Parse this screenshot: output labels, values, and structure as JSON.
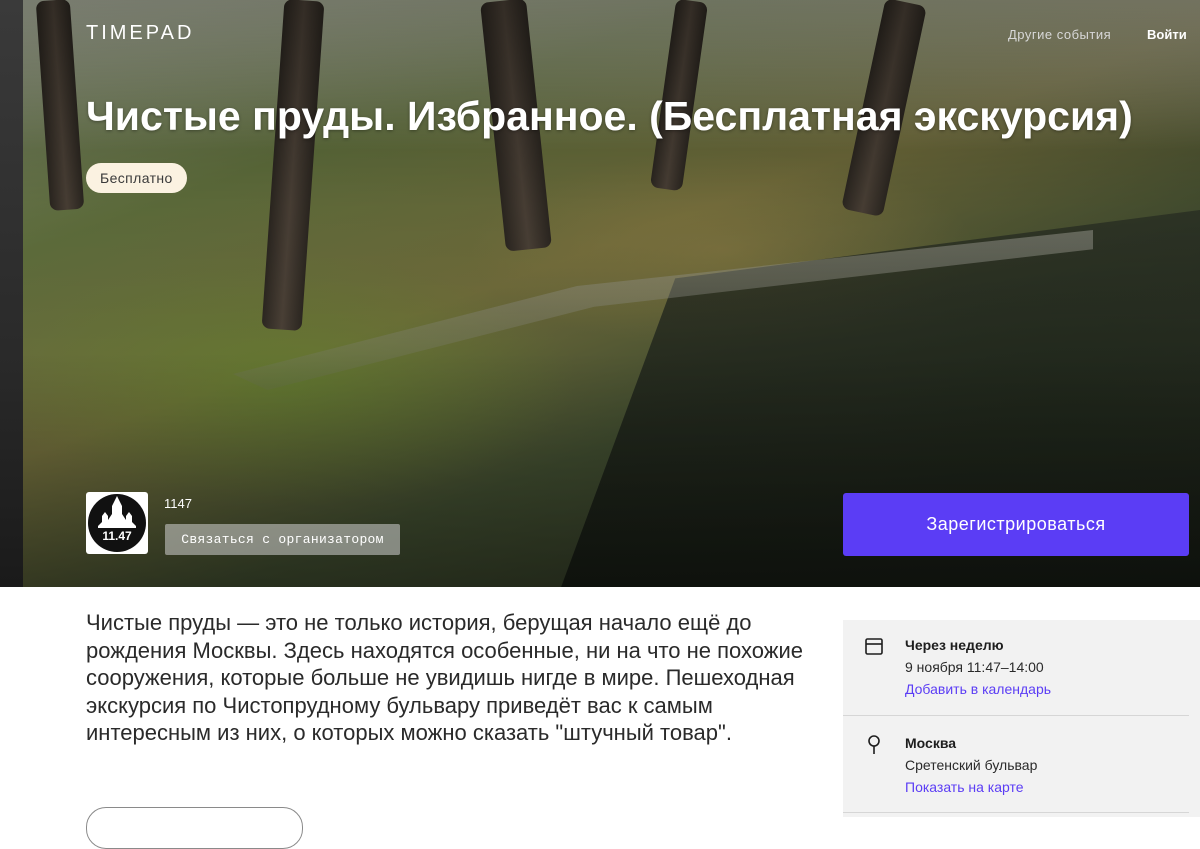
{
  "header": {
    "logo": "TIMEPAD",
    "nav_other_events": "Другие события",
    "nav_login": "Войти"
  },
  "event": {
    "title": "Чистые пруды. Избранное. (Бесплатная экскурсия)",
    "price_badge": "Бесплатно",
    "description": "Чистые пруды — это не только история, берущая начало ещё до рождения Москвы. Здесь находятся особенные, ни на что не похожие сооружения, которые больше не увидишь нигде в мире. Пешеходная экскурсия по Чистопрудному бульвару приведёт вас к самым интересным из них, о которых можно сказать \"штучный товар\"."
  },
  "organizer": {
    "name": "1147",
    "avatar_text": "11.47",
    "contact_button": "Связаться с организатором"
  },
  "register_button": "Зарегистрироваться",
  "info": {
    "date": {
      "icon": "calendar-icon",
      "title": "Через неделю",
      "time": "9 ноября 11:47–14:00",
      "link": "Добавить в календарь"
    },
    "location": {
      "icon": "map-pin-icon",
      "title": "Москва",
      "address": "Сретенский бульвар",
      "link": "Показать на карте"
    }
  },
  "colors": {
    "accent": "#5b3df5",
    "badge_bg": "#fbf2e1",
    "panel_bg": "#f2f2f2"
  }
}
